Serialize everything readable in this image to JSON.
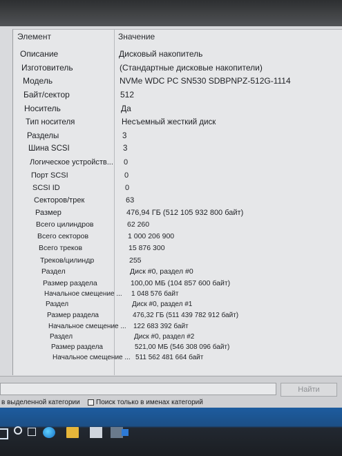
{
  "columns": {
    "name": "Элемент",
    "value": "Значение"
  },
  "rows": [
    {
      "name": "Описание",
      "value": "Дисковый накопитель"
    },
    {
      "name": "Изготовитель",
      "value": "(Стандартные дисковые накопители)"
    },
    {
      "name": "Модель",
      "value": "NVMe WDC PC SN530 SDBPNPZ-512G-1114"
    },
    {
      "name": "Байт/сектор",
      "value": "512"
    },
    {
      "name": "Носитель",
      "value": "Да"
    },
    {
      "name": "Тип носителя",
      "value": "Несъемный жесткий диск"
    },
    {
      "name": "Разделы",
      "value": "3"
    },
    {
      "name": "Шина SCSI",
      "value": "3"
    },
    {
      "name": "Логическое устройств...",
      "value": "0"
    },
    {
      "name": "Порт SCSI",
      "value": "0"
    },
    {
      "name": "SCSI ID",
      "value": "0"
    },
    {
      "name": "Секторов/трек",
      "value": "63"
    },
    {
      "name": "Размер",
      "value": "476,94 ГБ (512 105 932 800 байт)"
    },
    {
      "name": "Всего цилиндров",
      "value": "62 260"
    },
    {
      "name": "Всего секторов",
      "value": "1 000 206 900"
    },
    {
      "name": "Всего треков",
      "value": "15 876 300"
    },
    {
      "name": "Треков/цилиндр",
      "value": "255"
    },
    {
      "name": "Раздел",
      "value": "Диск #0, раздел #0"
    },
    {
      "name": "Размер раздела",
      "value": "100,00 МБ (104 857 600 байт)"
    },
    {
      "name": "Начальное смещение ...",
      "value": "1 048 576 байт"
    },
    {
      "name": "Раздел",
      "value": "Диск #0, раздел #1"
    },
    {
      "name": "Размер раздела",
      "value": "476,32 ГБ (511 439 782 912 байт)"
    },
    {
      "name": "Начальное смещение ...",
      "value": "122 683 392 байт"
    },
    {
      "name": "Раздел",
      "value": "Диск #0, раздел #2"
    },
    {
      "name": "Размер раздела",
      "value": "521,00 МБ (546 308 096 байт)"
    },
    {
      "name": "Начальное смещение ...",
      "value": "511 562 481 664 байт"
    }
  ],
  "bottom": {
    "find_label": "Найти",
    "option_selected_category": "в выделенной категории",
    "option_category_names": "Поиск только в именах категорий"
  },
  "colors": {
    "taskbar_accent": "#1d5c9f",
    "panel_bg": "#e6e7e9"
  }
}
